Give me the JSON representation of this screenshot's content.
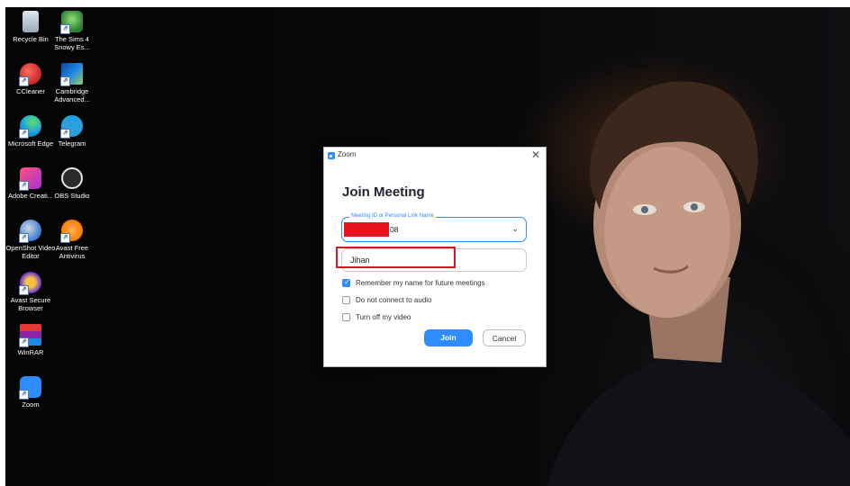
{
  "desktop": {
    "icons": [
      {
        "label": "Recycle Bin",
        "icon": "recycle-bin-icon",
        "color": "#c9d4de"
      },
      {
        "label": "The Sims 4 Snowy Es...",
        "icon": "sims-icon",
        "color": "#4caf50"
      },
      {
        "label": "CCleaner",
        "icon": "ccleaner-icon",
        "color": "#e53935"
      },
      {
        "label": "Cambridge Advanced...",
        "icon": "cambridge-icon",
        "color": "#1e88e5"
      },
      {
        "label": "Microsoft Edge",
        "icon": "edge-icon",
        "color": "#19a2e0"
      },
      {
        "label": "Telegram",
        "icon": "telegram-icon",
        "color": "#2aa1da"
      },
      {
        "label": "Adobe Creati...",
        "icon": "adobe-cc-icon",
        "color": "#e0245e"
      },
      {
        "label": "OBS Studio",
        "icon": "obs-icon",
        "color": "#2b2b2b"
      },
      {
        "label": "OpenShot Video Editor",
        "icon": "openshot-icon",
        "color": "#3a7bd5"
      },
      {
        "label": "Avast Free Antivirus",
        "icon": "avast-icon",
        "color": "#ff7800"
      },
      {
        "label": "Avast Secure Browser",
        "icon": "avast-browser-icon",
        "color": "#6a2fd6"
      },
      {
        "label": "WinRAR",
        "icon": "winrar-icon",
        "color": "#8e24aa"
      },
      {
        "label": "Zoom",
        "icon": "zoom-icon",
        "color": "#2d8cff"
      }
    ]
  },
  "dialog": {
    "title": "Zoom",
    "close": "✕",
    "heading": "Join Meeting",
    "meeting_id": {
      "legend": "Meeting ID or Personal Link Name",
      "value": "08",
      "chevron": "⌄"
    },
    "name_input": {
      "value": "Jihan"
    },
    "options": [
      {
        "label": "Remember my name for future meetings",
        "checked": true
      },
      {
        "label": "Do not connect to audio",
        "checked": false
      },
      {
        "label": "Turn off my video",
        "checked": false
      }
    ],
    "join_label": "Join",
    "cancel_label": "Cancel"
  },
  "colors": {
    "accent": "#2d8cff",
    "highlight": "#d11a23",
    "redaction": "#e8131c"
  }
}
